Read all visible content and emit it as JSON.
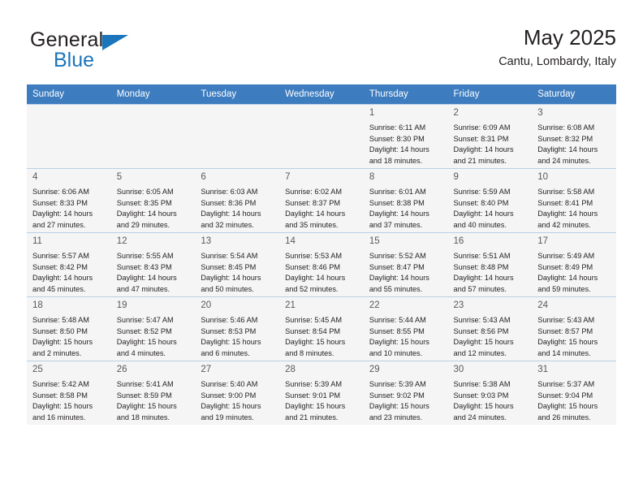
{
  "brand": {
    "name_part1": "General",
    "name_part2": "Blue",
    "accent_color": "#1b75bc"
  },
  "header": {
    "title": "May 2025",
    "subtitle": "Cantu, Lombardy, Italy"
  },
  "calendar": {
    "header_bg": "#3c7cbf",
    "weekdays": [
      "Sunday",
      "Monday",
      "Tuesday",
      "Wednesday",
      "Thursday",
      "Friday",
      "Saturday"
    ],
    "weeks": [
      [
        {
          "day": "",
          "detail": ""
        },
        {
          "day": "",
          "detail": ""
        },
        {
          "day": "",
          "detail": ""
        },
        {
          "day": "",
          "detail": ""
        },
        {
          "day": "1",
          "detail": "Sunrise: 6:11 AM\nSunset: 8:30 PM\nDaylight: 14 hours\nand 18 minutes."
        },
        {
          "day": "2",
          "detail": "Sunrise: 6:09 AM\nSunset: 8:31 PM\nDaylight: 14 hours\nand 21 minutes."
        },
        {
          "day": "3",
          "detail": "Sunrise: 6:08 AM\nSunset: 8:32 PM\nDaylight: 14 hours\nand 24 minutes."
        }
      ],
      [
        {
          "day": "4",
          "detail": "Sunrise: 6:06 AM\nSunset: 8:33 PM\nDaylight: 14 hours\nand 27 minutes."
        },
        {
          "day": "5",
          "detail": "Sunrise: 6:05 AM\nSunset: 8:35 PM\nDaylight: 14 hours\nand 29 minutes."
        },
        {
          "day": "6",
          "detail": "Sunrise: 6:03 AM\nSunset: 8:36 PM\nDaylight: 14 hours\nand 32 minutes."
        },
        {
          "day": "7",
          "detail": "Sunrise: 6:02 AM\nSunset: 8:37 PM\nDaylight: 14 hours\nand 35 minutes."
        },
        {
          "day": "8",
          "detail": "Sunrise: 6:01 AM\nSunset: 8:38 PM\nDaylight: 14 hours\nand 37 minutes."
        },
        {
          "day": "9",
          "detail": "Sunrise: 5:59 AM\nSunset: 8:40 PM\nDaylight: 14 hours\nand 40 minutes."
        },
        {
          "day": "10",
          "detail": "Sunrise: 5:58 AM\nSunset: 8:41 PM\nDaylight: 14 hours\nand 42 minutes."
        }
      ],
      [
        {
          "day": "11",
          "detail": "Sunrise: 5:57 AM\nSunset: 8:42 PM\nDaylight: 14 hours\nand 45 minutes."
        },
        {
          "day": "12",
          "detail": "Sunrise: 5:55 AM\nSunset: 8:43 PM\nDaylight: 14 hours\nand 47 minutes."
        },
        {
          "day": "13",
          "detail": "Sunrise: 5:54 AM\nSunset: 8:45 PM\nDaylight: 14 hours\nand 50 minutes."
        },
        {
          "day": "14",
          "detail": "Sunrise: 5:53 AM\nSunset: 8:46 PM\nDaylight: 14 hours\nand 52 minutes."
        },
        {
          "day": "15",
          "detail": "Sunrise: 5:52 AM\nSunset: 8:47 PM\nDaylight: 14 hours\nand 55 minutes."
        },
        {
          "day": "16",
          "detail": "Sunrise: 5:51 AM\nSunset: 8:48 PM\nDaylight: 14 hours\nand 57 minutes."
        },
        {
          "day": "17",
          "detail": "Sunrise: 5:49 AM\nSunset: 8:49 PM\nDaylight: 14 hours\nand 59 minutes."
        }
      ],
      [
        {
          "day": "18",
          "detail": "Sunrise: 5:48 AM\nSunset: 8:50 PM\nDaylight: 15 hours\nand 2 minutes."
        },
        {
          "day": "19",
          "detail": "Sunrise: 5:47 AM\nSunset: 8:52 PM\nDaylight: 15 hours\nand 4 minutes."
        },
        {
          "day": "20",
          "detail": "Sunrise: 5:46 AM\nSunset: 8:53 PM\nDaylight: 15 hours\nand 6 minutes."
        },
        {
          "day": "21",
          "detail": "Sunrise: 5:45 AM\nSunset: 8:54 PM\nDaylight: 15 hours\nand 8 minutes."
        },
        {
          "day": "22",
          "detail": "Sunrise: 5:44 AM\nSunset: 8:55 PM\nDaylight: 15 hours\nand 10 minutes."
        },
        {
          "day": "23",
          "detail": "Sunrise: 5:43 AM\nSunset: 8:56 PM\nDaylight: 15 hours\nand 12 minutes."
        },
        {
          "day": "24",
          "detail": "Sunrise: 5:43 AM\nSunset: 8:57 PM\nDaylight: 15 hours\nand 14 minutes."
        }
      ],
      [
        {
          "day": "25",
          "detail": "Sunrise: 5:42 AM\nSunset: 8:58 PM\nDaylight: 15 hours\nand 16 minutes."
        },
        {
          "day": "26",
          "detail": "Sunrise: 5:41 AM\nSunset: 8:59 PM\nDaylight: 15 hours\nand 18 minutes."
        },
        {
          "day": "27",
          "detail": "Sunrise: 5:40 AM\nSunset: 9:00 PM\nDaylight: 15 hours\nand 19 minutes."
        },
        {
          "day": "28",
          "detail": "Sunrise: 5:39 AM\nSunset: 9:01 PM\nDaylight: 15 hours\nand 21 minutes."
        },
        {
          "day": "29",
          "detail": "Sunrise: 5:39 AM\nSunset: 9:02 PM\nDaylight: 15 hours\nand 23 minutes."
        },
        {
          "day": "30",
          "detail": "Sunrise: 5:38 AM\nSunset: 9:03 PM\nDaylight: 15 hours\nand 24 minutes."
        },
        {
          "day": "31",
          "detail": "Sunrise: 5:37 AM\nSunset: 9:04 PM\nDaylight: 15 hours\nand 26 minutes."
        }
      ]
    ]
  }
}
